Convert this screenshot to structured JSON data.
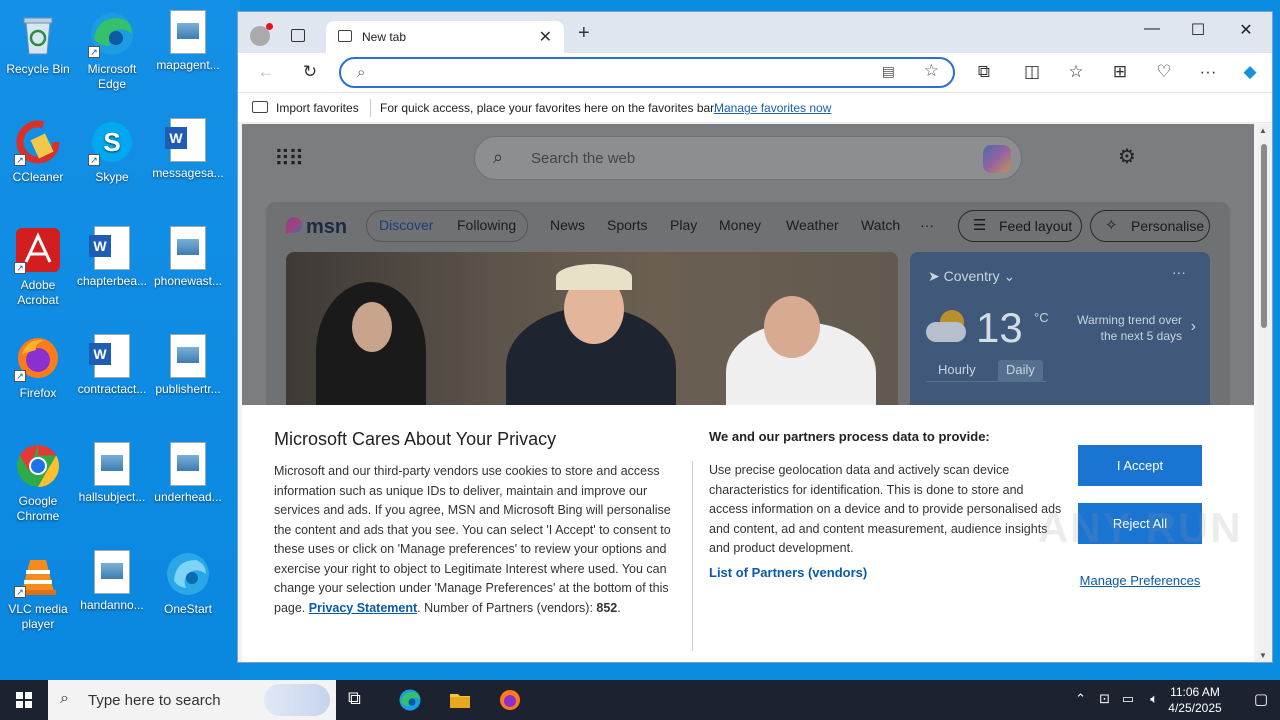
{
  "desktop": {
    "icons": [
      {
        "label": "Recycle Bin",
        "icon": "recycle-bin-icon"
      },
      {
        "label": "Microsoft Edge",
        "icon": "edge-icon"
      },
      {
        "label": "mapagent...",
        "icon": "image-file-icon"
      },
      {
        "label": "CCleaner",
        "icon": "ccleaner-icon"
      },
      {
        "label": "Skype",
        "icon": "skype-icon"
      },
      {
        "label": "messagesa...",
        "icon": "word-doc-icon"
      },
      {
        "label": "Adobe Acrobat",
        "icon": "acrobat-icon"
      },
      {
        "label": "chapterbea...",
        "icon": "word-doc-icon"
      },
      {
        "label": "phonewast...",
        "icon": "image-file-icon"
      },
      {
        "label": "Firefox",
        "icon": "firefox-icon"
      },
      {
        "label": "contractact...",
        "icon": "word-doc-icon"
      },
      {
        "label": "publishertr...",
        "icon": "image-file-icon"
      },
      {
        "label": "Google Chrome",
        "icon": "chrome-icon"
      },
      {
        "label": "hallsubject...",
        "icon": "image-file-icon"
      },
      {
        "label": "underhead...",
        "icon": "image-file-icon"
      },
      {
        "label": "VLC media player",
        "icon": "vlc-icon"
      },
      {
        "label": "handanno...",
        "icon": "image-file-icon"
      },
      {
        "label": "OneStart",
        "icon": "onestart-icon"
      }
    ]
  },
  "browser": {
    "tab_title": "New tab",
    "tab_close": "✕",
    "new_tab": "+",
    "window_controls": {
      "minimize": "—",
      "maximize": "☐",
      "close": "✕"
    },
    "address": {
      "value": "",
      "placeholder": ""
    },
    "favbar": {
      "import_label": "Import favorites",
      "hint": "For quick access, place your favorites here on the favorites bar.",
      "manage_link": "Manage favorites now"
    }
  },
  "newtab": {
    "search_placeholder": "Search the web",
    "msn": {
      "logo": "msn",
      "nav": [
        "Discover",
        "Following",
        "News",
        "Sports",
        "Play",
        "Money",
        "Weather",
        "Watch",
        "···"
      ],
      "feed_layout": "Feed layout",
      "personalise": "Personalise"
    },
    "weather": {
      "location": "Coventry",
      "temp": "13",
      "unit": "°C",
      "trend": "Warming trend over the next 5 days",
      "tab_hourly": "Hourly",
      "tab_daily": "Daily",
      "menu": "···"
    }
  },
  "privacy": {
    "title": "Microsoft Cares About Your Privacy",
    "body": "Microsoft and our third-party vendors use cookies to store and access information such as unique IDs to deliver, maintain and improve our services and ads. If you agree, MSN and Microsoft Bing will personalise the content and ads that you see. You can select 'I Accept' to consent to these uses or click on 'Manage preferences' to review your options and exercise your right to object to Legitimate Interest where used.  You can change your selection under 'Manage Preferences' at the bottom of this page.",
    "privacy_link": "Privacy Statement",
    "partners_count_label": "Number of Partners (vendors):",
    "partners_count": "852",
    "right_title": "We and our partners process data to provide:",
    "right_body": "Use precise geolocation data and actively scan device characteristics for identification. This is done to store and access information on a device and to provide personalised ads and content, ad and content measurement, audience insights and product development.",
    "partners_link": "List of Partners (vendors)",
    "accept": "I Accept",
    "reject": "Reject All",
    "manage": "Manage Preferences"
  },
  "watermark": "ANY RUN",
  "taskbar": {
    "search_placeholder": "Type here to search",
    "time": "11:06 AM",
    "date": "4/25/2025"
  },
  "colors": {
    "accent": "#1a74d2",
    "desktop": "#0a8de0",
    "taskbar": "#1c2230"
  }
}
